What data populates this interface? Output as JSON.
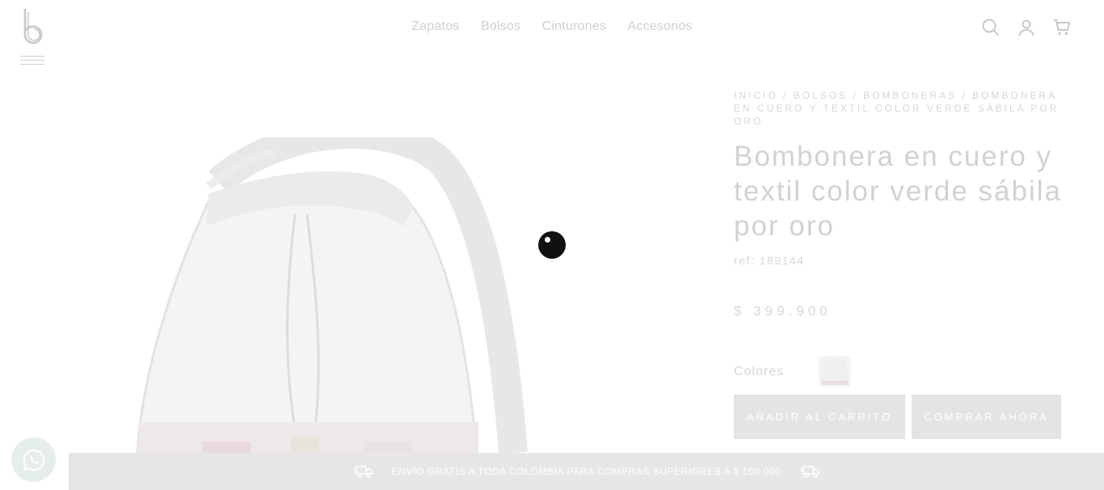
{
  "header": {
    "logo": "b",
    "nav": [
      {
        "label": "Zapatos"
      },
      {
        "label": "Bolsos"
      },
      {
        "label": "Cinturones"
      },
      {
        "label": "Accesorios"
      }
    ],
    "icons": [
      "search-icon",
      "user-icon",
      "cart-icon"
    ]
  },
  "breadcrumb": {
    "items": [
      "INICIO",
      "BOLSOS",
      "BOMBONERAS",
      "BOMBONERA EN CUERO Y TEXTIL COLOR VERDE SÁBILA POR ORO"
    ],
    "separator": " / "
  },
  "product": {
    "title": "Bombonera en cuero y textil color verde sábila por oro",
    "ref": "ref: 189144",
    "price": "$ 399.900",
    "colors_label": "Colores",
    "add_to_cart": "AÑADIR AL CARRITO",
    "buy_now": "COMPRAR AHORA"
  },
  "shipping_bar": {
    "text": "ENVÍO GRATIS A TODA COLOMBIA PARA COMPRAS SUPERIORES A $ 100.000"
  },
  "colors": {
    "overlay_gray": "#e4e4e4",
    "text_faded": "#d2d2d2",
    "zoom_dot": "#111111"
  }
}
